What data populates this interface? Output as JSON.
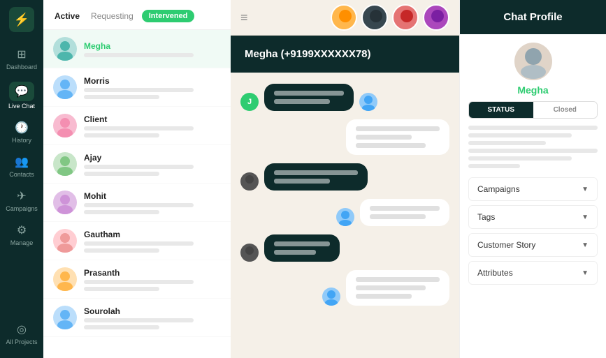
{
  "sidebar": {
    "logo": "⚡",
    "items": [
      {
        "id": "dashboard",
        "label": "Dashboard",
        "icon": "⊞",
        "active": false
      },
      {
        "id": "live-chat",
        "label": "Live Chat",
        "icon": "💬",
        "active": true
      },
      {
        "id": "history",
        "label": "History",
        "icon": "🕐",
        "active": false
      },
      {
        "id": "contacts",
        "label": "Contacts",
        "icon": "👥",
        "active": false
      },
      {
        "id": "campaigns",
        "label": "Campaigns",
        "icon": "✈",
        "active": false
      },
      {
        "id": "manage",
        "label": "Manage",
        "icon": "⚙",
        "active": false
      },
      {
        "id": "all-projects",
        "label": "All Projects",
        "icon": "◎",
        "active": false
      }
    ]
  },
  "chatList": {
    "tabs": [
      {
        "id": "active",
        "label": "Active",
        "active": true
      },
      {
        "id": "requesting",
        "label": "Requesting",
        "active": false
      },
      {
        "id": "intervened",
        "label": "Intervened",
        "active": false,
        "badge": true
      }
    ],
    "contacts": [
      {
        "id": 1,
        "name": "Megha",
        "highlight": true,
        "avatarColor": "av-teal",
        "selected": true
      },
      {
        "id": 2,
        "name": "Morris",
        "highlight": false,
        "avatarColor": "av-blue"
      },
      {
        "id": 3,
        "name": "Client",
        "highlight": false,
        "avatarColor": "av-pink"
      },
      {
        "id": 4,
        "name": "Ajay",
        "highlight": false,
        "avatarColor": "av-green"
      },
      {
        "id": 5,
        "name": "Mohit",
        "highlight": false,
        "avatarColor": "av-purple"
      },
      {
        "id": 6,
        "name": "Gautham",
        "highlight": false,
        "avatarColor": "av-red"
      },
      {
        "id": 7,
        "name": "Prasanth",
        "highlight": false,
        "avatarColor": "av-orange"
      },
      {
        "id": 8,
        "name": "Sourolah",
        "highlight": false,
        "avatarColor": "av-blue"
      }
    ]
  },
  "chat": {
    "header": "Megha (+9199XXXXXX78)",
    "hamburger": "≡"
  },
  "profile": {
    "header": "Chat Profile",
    "name": "Megha",
    "status_label": "STATUS",
    "closed_label": "Closed",
    "accordions": [
      {
        "id": "campaigns",
        "label": "Campaigns"
      },
      {
        "id": "tags",
        "label": "Tags"
      },
      {
        "id": "customer-story",
        "label": "Customer Story"
      },
      {
        "id": "attributes",
        "label": "Attributes"
      }
    ]
  },
  "topAvatars": [
    {
      "id": 1,
      "color": "av-orange"
    },
    {
      "id": 2,
      "color": "av-dark"
    },
    {
      "id": 3,
      "color": "av-red"
    },
    {
      "id": 4,
      "color": "av-purple"
    }
  ]
}
